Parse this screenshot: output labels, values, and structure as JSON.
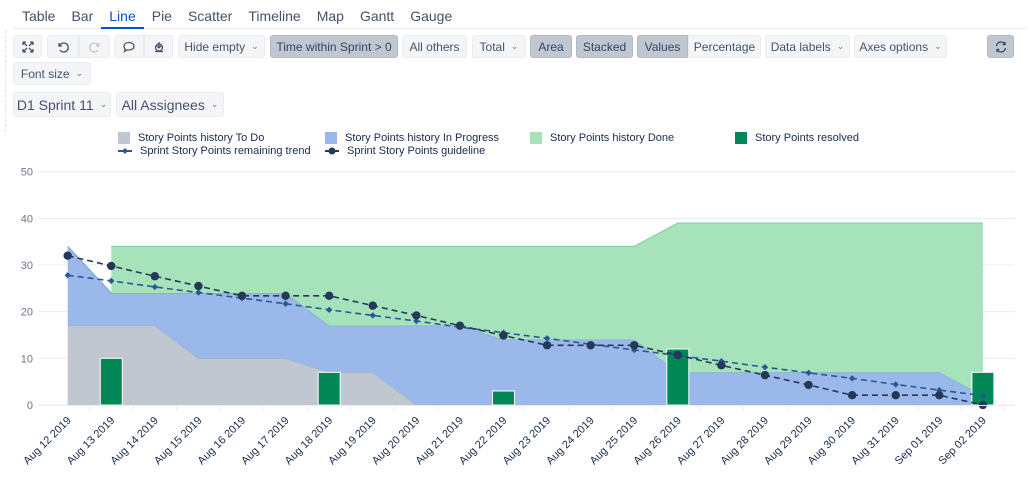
{
  "tabs": [
    "Table",
    "Bar",
    "Line",
    "Pie",
    "Scatter",
    "Timeline",
    "Map",
    "Gantt",
    "Gauge"
  ],
  "active_tab": "Line",
  "toolbar": {
    "hide_empty": "Hide empty",
    "time_filter": "Time within Sprint > 0",
    "all_others": "All others",
    "total": "Total",
    "area": "Area",
    "stacked": "Stacked",
    "values": "Values",
    "percentage": "Percentage",
    "data_labels": "Data labels",
    "axes_options": "Axes options",
    "font_size": "Font size"
  },
  "filters": {
    "sprint": "D1 Sprint 11",
    "assignees": "All Assignees"
  },
  "colors": {
    "todo": "#c1c7d0",
    "in_progress": "#9ab9ea",
    "done": "#a6e3bb",
    "resolved": "#008755",
    "trend": "#2b5797",
    "guideline": "#253858",
    "accent": "#0052cc"
  },
  "chart_data": {
    "type": "area",
    "stacked": true,
    "ylim": [
      0,
      50
    ],
    "yticks": [
      0,
      10,
      20,
      30,
      40,
      50
    ],
    "grid": true,
    "legend_placement": "top",
    "categories": [
      "Aug 12 2019",
      "Aug 13 2019",
      "Aug 14 2019",
      "Aug 15 2019",
      "Aug 16 2019",
      "Aug 17 2019",
      "Aug 18 2019",
      "Aug 19 2019",
      "Aug 20 2019",
      "Aug 21 2019",
      "Aug 22 2019",
      "Aug 23 2019",
      "Aug 24 2019",
      "Aug 25 2019",
      "Aug 26 2019",
      "Aug 27 2019",
      "Aug 28 2019",
      "Aug 29 2019",
      "Aug 30 2019",
      "Aug 31 2019",
      "Sep 01 2019",
      "Sep 02 2019"
    ],
    "series": [
      {
        "name": "Story Points history To Do",
        "kind": "area",
        "values": [
          17,
          17,
          17,
          10,
          10,
          10,
          7,
          7,
          0,
          0,
          0,
          0,
          0,
          0,
          0,
          0,
          0,
          0,
          0,
          0,
          0,
          0
        ]
      },
      {
        "name": "Story Points history In Progress",
        "kind": "area",
        "values": [
          17,
          7,
          7,
          14,
          14,
          14,
          10,
          10,
          17,
          17,
          14,
          14,
          14,
          14,
          7,
          7,
          7,
          7,
          7,
          7,
          7,
          2
        ]
      },
      {
        "name": "Story Points history Done",
        "kind": "area",
        "values": [
          null,
          10,
          10,
          10,
          10,
          10,
          17,
          17,
          17,
          17,
          20,
          20,
          20,
          20,
          32,
          32,
          32,
          32,
          32,
          32,
          32,
          37
        ]
      },
      {
        "name": "Story Points resolved",
        "kind": "bar",
        "values": [
          0,
          10,
          0,
          0,
          0,
          0,
          7,
          0,
          0,
          0,
          3,
          0,
          0,
          0,
          12,
          0,
          0,
          0,
          0,
          0,
          0,
          7
        ]
      },
      {
        "name": "Sprint Story Points remaining trend",
        "kind": "line",
        "values": [
          27.8,
          26.6,
          25.3,
          24.1,
          22.9,
          21.7,
          20.4,
          19.2,
          18.0,
          16.7,
          15.5,
          14.3,
          13.0,
          11.8,
          10.6,
          9.4,
          8.1,
          6.9,
          5.7,
          4.4,
          3.2,
          2.0
        ]
      },
      {
        "name": "Sprint Story Points guideline",
        "kind": "line",
        "values": [
          32,
          29.8,
          27.6,
          25.5,
          23.4,
          23.4,
          23.4,
          21.3,
          19.2,
          17,
          14.9,
          12.8,
          12.8,
          12.8,
          10.7,
          8.5,
          6.4,
          4.3,
          2.1,
          2.1,
          2.1,
          0
        ]
      }
    ]
  }
}
